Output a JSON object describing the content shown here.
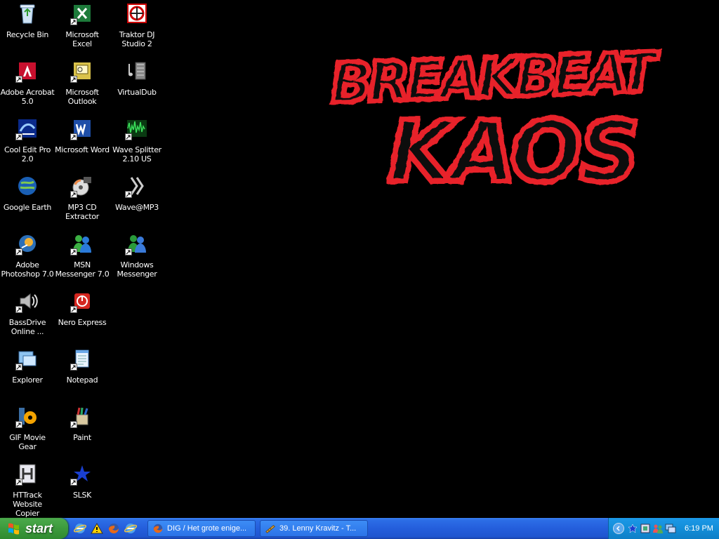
{
  "desktop": {
    "background_color": "#000000",
    "icons": [
      {
        "label": "Recycle Bin",
        "icon": "recycle-bin-icon",
        "shortcut": false
      },
      {
        "label": "Microsoft Excel",
        "icon": "excel-icon",
        "shortcut": true
      },
      {
        "label": "Traktor DJ Studio 2",
        "icon": "traktor-icon",
        "shortcut": false
      },
      {
        "label": "Adobe Acrobat 5.0",
        "icon": "acrobat-icon",
        "shortcut": true
      },
      {
        "label": "Microsoft Outlook",
        "icon": "outlook-icon",
        "shortcut": true
      },
      {
        "label": "VirtualDub",
        "icon": "virtualdub-icon",
        "shortcut": false
      },
      {
        "label": "Cool Edit Pro 2.0",
        "icon": "cool-edit-icon",
        "shortcut": true
      },
      {
        "label": "Microsoft Word",
        "icon": "word-icon",
        "shortcut": true
      },
      {
        "label": "Wave Splitter 2.10 US",
        "icon": "wave-splitter-icon",
        "shortcut": true
      },
      {
        "label": "Google Earth",
        "icon": "google-earth-icon",
        "shortcut": false
      },
      {
        "label": "MP3 CD Extractor",
        "icon": "mp3-cd-extractor-icon",
        "shortcut": true
      },
      {
        "label": "Wave@MP3",
        "icon": "wave-mp3-icon",
        "shortcut": true
      },
      {
        "label": "Adobe Photoshop 7.0",
        "icon": "photoshop-icon",
        "shortcut": true
      },
      {
        "label": "MSN Messenger 7.0",
        "icon": "msn-messenger-icon",
        "shortcut": true
      },
      {
        "label": "Windows Messenger",
        "icon": "windows-messenger-icon",
        "shortcut": true
      },
      {
        "label": "BassDrive Online ...",
        "icon": "bassdrive-icon",
        "shortcut": true
      },
      {
        "label": "Nero Express",
        "icon": "nero-icon",
        "shortcut": true
      },
      {
        "label": "Explorer",
        "icon": "explorer-icon",
        "shortcut": true
      },
      {
        "label": "Notepad",
        "icon": "notepad-icon",
        "shortcut": true
      },
      {
        "label": "GIF Movie Gear",
        "icon": "gif-movie-gear-icon",
        "shortcut": true
      },
      {
        "label": "Paint",
        "icon": "paint-icon",
        "shortcut": true
      },
      {
        "label": "HTTrack Website Copier",
        "icon": "httrack-icon",
        "shortcut": true
      },
      {
        "label": "SLSK",
        "icon": "slsk-icon",
        "shortcut": true
      }
    ],
    "wallpaper_logo": {
      "line1": "BREAKBEAT",
      "line2": "KAOS",
      "color": "#e8202a"
    }
  },
  "taskbar": {
    "start_label": "start",
    "quicklaunch": [
      "ie-icon",
      "warning-icon",
      "firefox-icon",
      "ie-icon-2"
    ],
    "tasks": [
      {
        "label": "DIG / Het grote enige...",
        "icon": "firefox-icon"
      },
      {
        "label": "39. Lenny Kravitz - T...",
        "icon": "media-icon"
      }
    ],
    "tray_icons": [
      "slsk-tray-icon",
      "network-icon",
      "users-icon",
      "monitor-icon"
    ],
    "clock": "6:19 PM"
  }
}
